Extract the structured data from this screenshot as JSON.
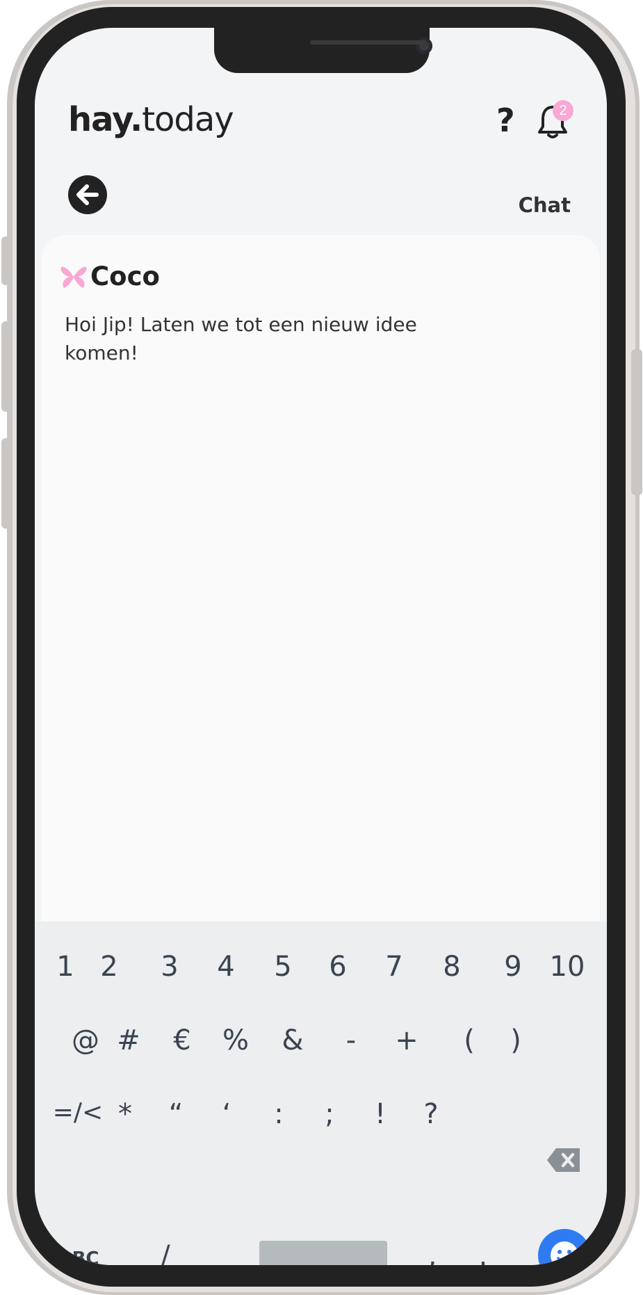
{
  "app": {
    "logo_bold": "hay.",
    "logo_light": "today",
    "help_icon": "?",
    "notification_count": "2",
    "page_label": "Chat",
    "accent_color": "#f9a8d4",
    "emoji_button_color": "#2f7bf2"
  },
  "chat": {
    "sender_name": "Coco",
    "message": "Hoi Jip! Laten we tot een nieuw idee komen!"
  },
  "keyboard": {
    "row1": [
      "1",
      "2",
      "3",
      "4",
      "5",
      "6",
      "7",
      "8",
      "9",
      "10"
    ],
    "row2": [
      "@",
      "#",
      "€",
      "%",
      "&",
      "-",
      "+",
      "(",
      ")"
    ],
    "row3": [
      "=/<",
      "*",
      "“",
      "‘",
      ":",
      ";",
      "!",
      "?"
    ],
    "row4": {
      "abc": "ABC",
      "underscore": "_",
      "slash": "/",
      "comma": ",",
      "period": "."
    }
  }
}
